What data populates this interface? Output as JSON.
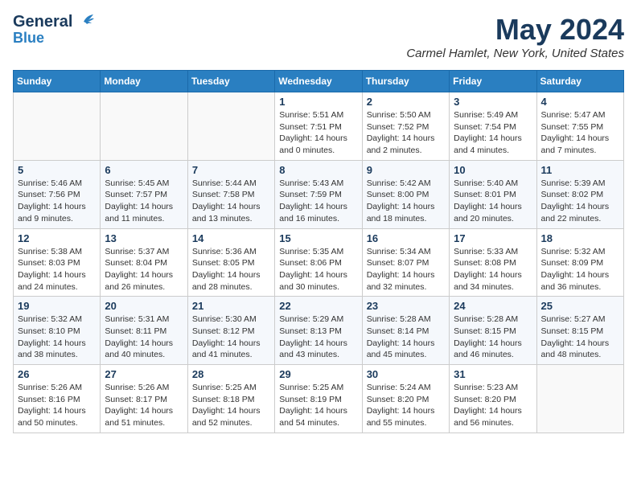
{
  "header": {
    "logo_line1": "General",
    "logo_line2": "Blue",
    "month_year": "May 2024",
    "location": "Carmel Hamlet, New York, United States"
  },
  "days_of_week": [
    "Sunday",
    "Monday",
    "Tuesday",
    "Wednesday",
    "Thursday",
    "Friday",
    "Saturday"
  ],
  "weeks": [
    [
      {
        "day": "",
        "info": ""
      },
      {
        "day": "",
        "info": ""
      },
      {
        "day": "",
        "info": ""
      },
      {
        "day": "1",
        "info": "Sunrise: 5:51 AM\nSunset: 7:51 PM\nDaylight: 14 hours\nand 0 minutes."
      },
      {
        "day": "2",
        "info": "Sunrise: 5:50 AM\nSunset: 7:52 PM\nDaylight: 14 hours\nand 2 minutes."
      },
      {
        "day": "3",
        "info": "Sunrise: 5:49 AM\nSunset: 7:54 PM\nDaylight: 14 hours\nand 4 minutes."
      },
      {
        "day": "4",
        "info": "Sunrise: 5:47 AM\nSunset: 7:55 PM\nDaylight: 14 hours\nand 7 minutes."
      }
    ],
    [
      {
        "day": "5",
        "info": "Sunrise: 5:46 AM\nSunset: 7:56 PM\nDaylight: 14 hours\nand 9 minutes."
      },
      {
        "day": "6",
        "info": "Sunrise: 5:45 AM\nSunset: 7:57 PM\nDaylight: 14 hours\nand 11 minutes."
      },
      {
        "day": "7",
        "info": "Sunrise: 5:44 AM\nSunset: 7:58 PM\nDaylight: 14 hours\nand 13 minutes."
      },
      {
        "day": "8",
        "info": "Sunrise: 5:43 AM\nSunset: 7:59 PM\nDaylight: 14 hours\nand 16 minutes."
      },
      {
        "day": "9",
        "info": "Sunrise: 5:42 AM\nSunset: 8:00 PM\nDaylight: 14 hours\nand 18 minutes."
      },
      {
        "day": "10",
        "info": "Sunrise: 5:40 AM\nSunset: 8:01 PM\nDaylight: 14 hours\nand 20 minutes."
      },
      {
        "day": "11",
        "info": "Sunrise: 5:39 AM\nSunset: 8:02 PM\nDaylight: 14 hours\nand 22 minutes."
      }
    ],
    [
      {
        "day": "12",
        "info": "Sunrise: 5:38 AM\nSunset: 8:03 PM\nDaylight: 14 hours\nand 24 minutes."
      },
      {
        "day": "13",
        "info": "Sunrise: 5:37 AM\nSunset: 8:04 PM\nDaylight: 14 hours\nand 26 minutes."
      },
      {
        "day": "14",
        "info": "Sunrise: 5:36 AM\nSunset: 8:05 PM\nDaylight: 14 hours\nand 28 minutes."
      },
      {
        "day": "15",
        "info": "Sunrise: 5:35 AM\nSunset: 8:06 PM\nDaylight: 14 hours\nand 30 minutes."
      },
      {
        "day": "16",
        "info": "Sunrise: 5:34 AM\nSunset: 8:07 PM\nDaylight: 14 hours\nand 32 minutes."
      },
      {
        "day": "17",
        "info": "Sunrise: 5:33 AM\nSunset: 8:08 PM\nDaylight: 14 hours\nand 34 minutes."
      },
      {
        "day": "18",
        "info": "Sunrise: 5:32 AM\nSunset: 8:09 PM\nDaylight: 14 hours\nand 36 minutes."
      }
    ],
    [
      {
        "day": "19",
        "info": "Sunrise: 5:32 AM\nSunset: 8:10 PM\nDaylight: 14 hours\nand 38 minutes."
      },
      {
        "day": "20",
        "info": "Sunrise: 5:31 AM\nSunset: 8:11 PM\nDaylight: 14 hours\nand 40 minutes."
      },
      {
        "day": "21",
        "info": "Sunrise: 5:30 AM\nSunset: 8:12 PM\nDaylight: 14 hours\nand 41 minutes."
      },
      {
        "day": "22",
        "info": "Sunrise: 5:29 AM\nSunset: 8:13 PM\nDaylight: 14 hours\nand 43 minutes."
      },
      {
        "day": "23",
        "info": "Sunrise: 5:28 AM\nSunset: 8:14 PM\nDaylight: 14 hours\nand 45 minutes."
      },
      {
        "day": "24",
        "info": "Sunrise: 5:28 AM\nSunset: 8:15 PM\nDaylight: 14 hours\nand 46 minutes."
      },
      {
        "day": "25",
        "info": "Sunrise: 5:27 AM\nSunset: 8:15 PM\nDaylight: 14 hours\nand 48 minutes."
      }
    ],
    [
      {
        "day": "26",
        "info": "Sunrise: 5:26 AM\nSunset: 8:16 PM\nDaylight: 14 hours\nand 50 minutes."
      },
      {
        "day": "27",
        "info": "Sunrise: 5:26 AM\nSunset: 8:17 PM\nDaylight: 14 hours\nand 51 minutes."
      },
      {
        "day": "28",
        "info": "Sunrise: 5:25 AM\nSunset: 8:18 PM\nDaylight: 14 hours\nand 52 minutes."
      },
      {
        "day": "29",
        "info": "Sunrise: 5:25 AM\nSunset: 8:19 PM\nDaylight: 14 hours\nand 54 minutes."
      },
      {
        "day": "30",
        "info": "Sunrise: 5:24 AM\nSunset: 8:20 PM\nDaylight: 14 hours\nand 55 minutes."
      },
      {
        "day": "31",
        "info": "Sunrise: 5:23 AM\nSunset: 8:20 PM\nDaylight: 14 hours\nand 56 minutes."
      },
      {
        "day": "",
        "info": ""
      }
    ]
  ]
}
